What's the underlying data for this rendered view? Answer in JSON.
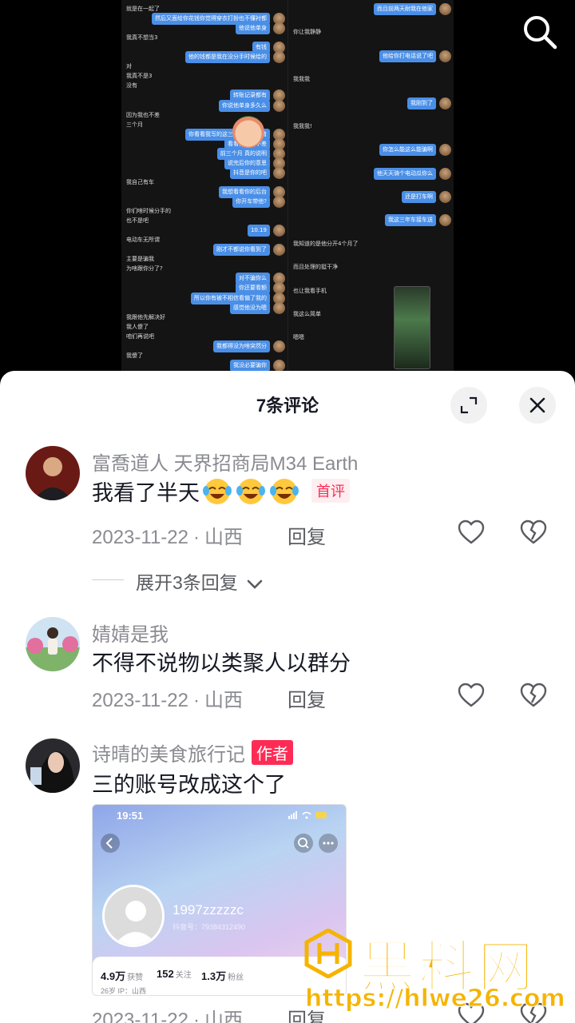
{
  "chat_screenshot": {
    "left": [
      {
        "t": "就是在一起了",
        "me": false
      },
      {
        "t": "然后又面给你花钱你觉得穿衣打扮也不懂衬都",
        "me": true
      },
      {
        "t": "他说他单身",
        "me": true
      },
      {
        "t": "我真不想当3",
        "me": false
      },
      {
        "t": "有钱",
        "me": true
      },
      {
        "t": "他的钱都是我在没分手时候给的",
        "me": true
      },
      {
        "t": "对",
        "me": false
      },
      {
        "t": "我真不是3",
        "me": false
      },
      {
        "t": "没有",
        "me": false
      },
      {
        "t": "转账记录都有",
        "me": true
      },
      {
        "t": "你说他单身多久么",
        "me": true
      },
      {
        "t": "因为我也不差",
        "me": false
      },
      {
        "t": "三个月",
        "me": false
      },
      {
        "t": "你看看我写的这三年都是我养着",
        "me": true
      },
      {
        "t": "看看你确实不差",
        "me": true
      },
      {
        "t": "前三个月 真的说明",
        "me": true
      },
      {
        "t": "说完后你的意思",
        "me": true
      },
      {
        "t": "抖音是你的吧",
        "me": true
      },
      {
        "t": "我自己有车",
        "me": false
      },
      {
        "t": "我想看看你的后台",
        "me": true
      },
      {
        "t": "你开车带他?",
        "me": true
      },
      {
        "t": "你们啥时候分手的",
        "me": false
      },
      {
        "t": "也不是吧",
        "me": false
      },
      {
        "t": "10.19",
        "me": true
      },
      {
        "t": "电动车无所谓",
        "me": false
      },
      {
        "t": "刚才不都说你看到了",
        "me": true
      },
      {
        "t": "主要是骗我",
        "me": false
      },
      {
        "t": "为啥跟你分了?",
        "me": false
      },
      {
        "t": "对不骗你么",
        "me": true
      },
      {
        "t": "你还要看额",
        "me": true
      },
      {
        "t": "所以你有被不相信看偏了我的",
        "me": true
      },
      {
        "t": "感觉他没为嗯",
        "me": true
      },
      {
        "t": "我跟他先解决好",
        "me": false
      },
      {
        "t": "我人傻了",
        "me": false
      },
      {
        "t": "咱们再说吧",
        "me": false
      },
      {
        "t": "我都得没为啥突然分",
        "me": true
      },
      {
        "t": "我傻了",
        "me": false
      },
      {
        "t": "我没必要骗你",
        "me": true
      }
    ],
    "right": [
      {
        "t": "而且前两天耐我在他家",
        "me": true
      },
      {
        "t": "你让我静静",
        "me": false
      },
      {
        "t": "他给你打电话说了吧",
        "me": true
      },
      {
        "t": "我我我",
        "me": false
      },
      {
        "t": "我刚到了",
        "me": true
      },
      {
        "t": "我我我!",
        "me": false
      },
      {
        "t": "你怎么能这么能骗啊",
        "me": true
      },
      {
        "t": "他天天骑个电动瓜你么",
        "me": true
      },
      {
        "t": "还是打车啊",
        "me": true
      },
      {
        "t": "我这三年车接车送",
        "me": true
      },
      {
        "t": "我知道的是他分开4个月了",
        "me": false
      },
      {
        "t": "而且处理的挺干净",
        "me": false
      },
      {
        "t": "也让我看手机",
        "me": false
      },
      {
        "t": "我这么简单",
        "me": false
      },
      {
        "t": "嗯嗯",
        "me": false
      }
    ]
  },
  "sheet": {
    "title": "7条评论"
  },
  "comments": [
    {
      "user": "富喬道人 天界招商局M34 Earth",
      "text": "我看了半天",
      "emoji_count": 3,
      "badge": "首评",
      "date": "2023-11-22",
      "location": "山西",
      "reply": "回复",
      "expand": "展开3条回复"
    },
    {
      "user": "婧婧是我",
      "text": "不得不说物以类聚人以群分",
      "date": "2023-11-22",
      "location": "山西",
      "reply": "回复"
    },
    {
      "user": "诗晴的美食旅行记",
      "badge": "作者",
      "text": "三的账号改成这个了",
      "date": "2023-11-22",
      "location": "山西",
      "reply": "回复",
      "embed": {
        "time": "19:51",
        "name": "1997zzzzzc",
        "id": "抖音号：79384312490",
        "likes_value": "4.9万",
        "likes_label": "获赞",
        "following_value": "152",
        "following_label": "关注",
        "followers_value": "1.3万",
        "followers_label": "粉丝",
        "tags": "26岁    IP：山西"
      }
    }
  ],
  "separator": "·",
  "watermark": {
    "title": "黑料网",
    "url": "https://hlwe26.com"
  },
  "colors": {
    "accent": "#fe2c55",
    "bubble": "#4a8fe7",
    "watermark": "#f5b400"
  },
  "icons": {
    "search": "search-icon",
    "expand": "expand-icon",
    "close": "close-icon",
    "like": "heart-icon",
    "dislike": "broken-heart-icon",
    "chevron": "chevron-down-icon"
  }
}
